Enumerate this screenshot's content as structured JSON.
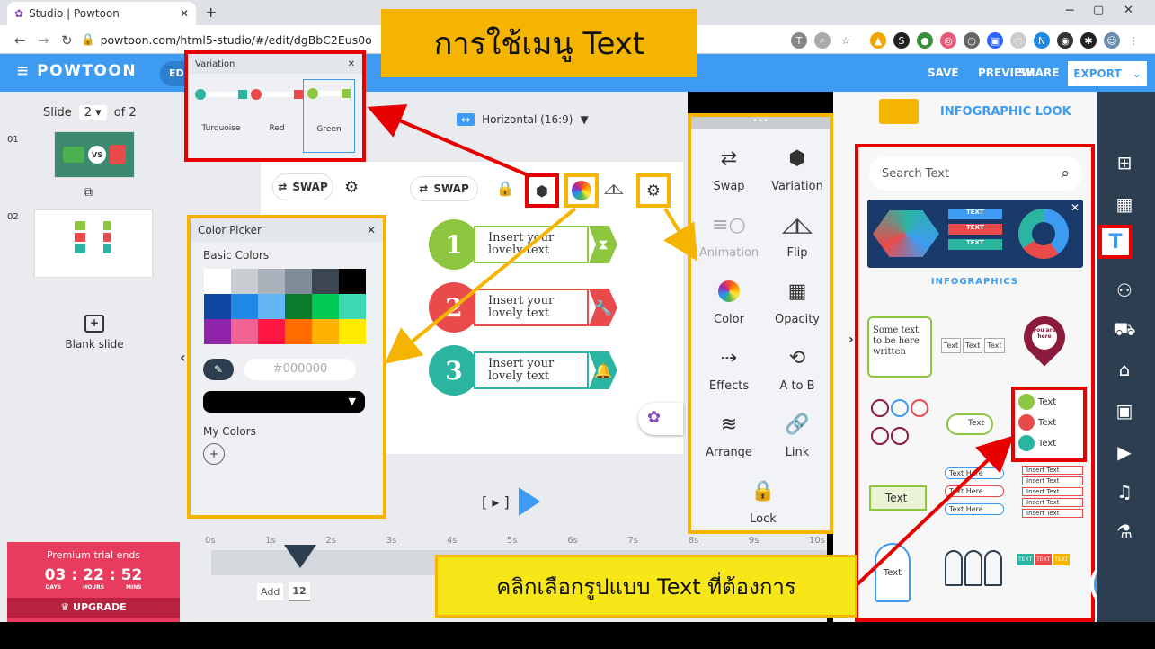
{
  "browser": {
    "tab_title": "Studio | Powtoon",
    "url": "powtoon.com/html5-studio/#/edit/dgBbC2Eus0o"
  },
  "header": {
    "logo": "POWTOON",
    "save": "SAVE",
    "preview": "PREVIEW",
    "share": "SHARE",
    "export": "EXPORT",
    "partial_tab": "ED"
  },
  "left_panel": {
    "slide_label": "Slide",
    "slide_value": "2",
    "slide_of": "of 2",
    "slide1_num": "01",
    "slide2_num": "02",
    "blank_slide": "Blank slide",
    "trial": {
      "title": "Premium trial ends",
      "days": "03",
      "hours": "22",
      "mins": "52",
      "days_l": "DAYS",
      "hours_l": "HOURS",
      "mins_l": "MINS",
      "upgrade": "UPGRADE"
    }
  },
  "canvas": {
    "aspect": "Horizontal (16:9)",
    "swap": "SWAP",
    "swap2": "SWAP",
    "items": [
      {
        "num": "1",
        "text": "Insert your lovely text",
        "color": "#8dc63f"
      },
      {
        "num": "2",
        "text": "Insert your lovely text",
        "color": "#e94b4b"
      },
      {
        "num": "3",
        "text": "Insert your lovely text",
        "color": "#2bb5a0"
      }
    ],
    "play_bracket": "[ ▸ ]"
  },
  "timeline": {
    "ticks": [
      "0s",
      "1s",
      "2s",
      "3s",
      "4s",
      "5s",
      "6s",
      "7s",
      "8s",
      "9s",
      "10s"
    ],
    "add": "Add",
    "duration": "12"
  },
  "variation_popup": {
    "title": "Variation",
    "options": [
      "Turquoise",
      "Red",
      "Green"
    ]
  },
  "color_picker": {
    "title": "Color Picker",
    "basic": "Basic Colors",
    "swatches": [
      "#ffffff",
      "#c9ced3",
      "#a9b2ba",
      "#7f8b96",
      "#3b4650",
      "#000000",
      "#0d47a1",
      "#1e88e5",
      "#64b5f6",
      "#0b7a2b",
      "#00c853",
      "#3fd9b5",
      "#8e24aa",
      "#f06292",
      "#ff1744",
      "#ff6d00",
      "#ffb300",
      "#ffea00"
    ],
    "hex": "#000000",
    "my_colors": "My Colors"
  },
  "menu": {
    "items": [
      {
        "label": "Swap",
        "icon": "⇄"
      },
      {
        "label": "Variation",
        "icon": "⬢"
      },
      {
        "label": "Animation",
        "icon": "≡○"
      },
      {
        "label": "Flip",
        "icon": "◿◺"
      },
      {
        "label": "Color",
        "icon": "●"
      },
      {
        "label": "Opacity",
        "icon": "▦"
      },
      {
        "label": "Effects",
        "icon": "⇢"
      },
      {
        "label": "A to B",
        "icon": "⟲"
      },
      {
        "label": "Arrange",
        "icon": "≋"
      },
      {
        "label": "Link",
        "icon": "🔗"
      },
      {
        "label": "Lock",
        "icon": "🔒"
      }
    ]
  },
  "right_panel": {
    "category": "INFOGRAPHIC LOOK",
    "search_placeholder": "Search Text",
    "section": "INFOGRAPHICS",
    "some_text": "Some text to be here written",
    "text": "Text",
    "text_here": "Text Here",
    "insert_text": "Insert Text",
    "you_are_here": "you are here",
    "text_caps": "TEXT"
  },
  "callouts": {
    "title": "การใช้เมนู Text",
    "bottom": "คลิกเลือกรูปแบบ Text ที่ต้องการ"
  },
  "colors": {
    "accent": "#3d9cf2",
    "highlight_red": "#e60000",
    "highlight_yellow": "#f5b400"
  }
}
